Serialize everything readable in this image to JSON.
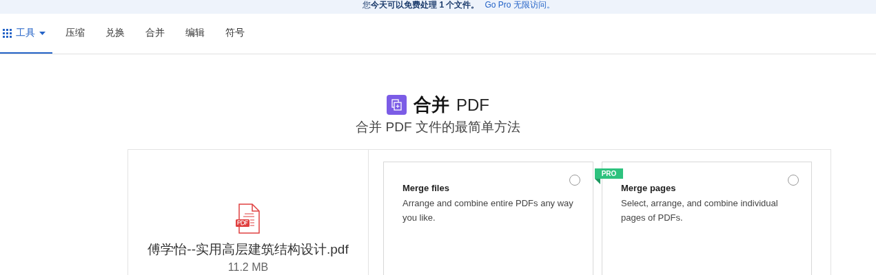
{
  "banner": {
    "text": "您**今天可以免费处理 1 个文件。**",
    "link": "Go Pro 无限访问。"
  },
  "tabs": [
    {
      "label": "工具",
      "selected": true,
      "kind": "menu"
    },
    {
      "label": "压缩",
      "selected": false,
      "kind": "plain"
    },
    {
      "label": "兑换",
      "selected": false,
      "kind": "plain"
    },
    {
      "label": "合并",
      "selected": false,
      "kind": "plain"
    },
    {
      "label": "编辑",
      "selected": false,
      "kind": "plain"
    },
    {
      "label": "符号",
      "selected": false,
      "kind": "plain"
    }
  ],
  "heading": {
    "title": "合并",
    "title_suffix": "PDF",
    "subtitle": "合并 PDF 文件的最简单方法"
  },
  "file": {
    "name": "傅学怡--实用高层建筑结构设计.pdf",
    "size": "11.2 MB"
  },
  "options": [
    {
      "title": "Merge files",
      "description": "Arrange and combine entire PDFs any way you like.",
      "selected": false,
      "pro": false
    },
    {
      "title": "Merge pages",
      "description": "Select, arrange, and combine individual pages of PDFs.",
      "selected": false,
      "pro": true,
      "badge": "PRO"
    }
  ]
}
